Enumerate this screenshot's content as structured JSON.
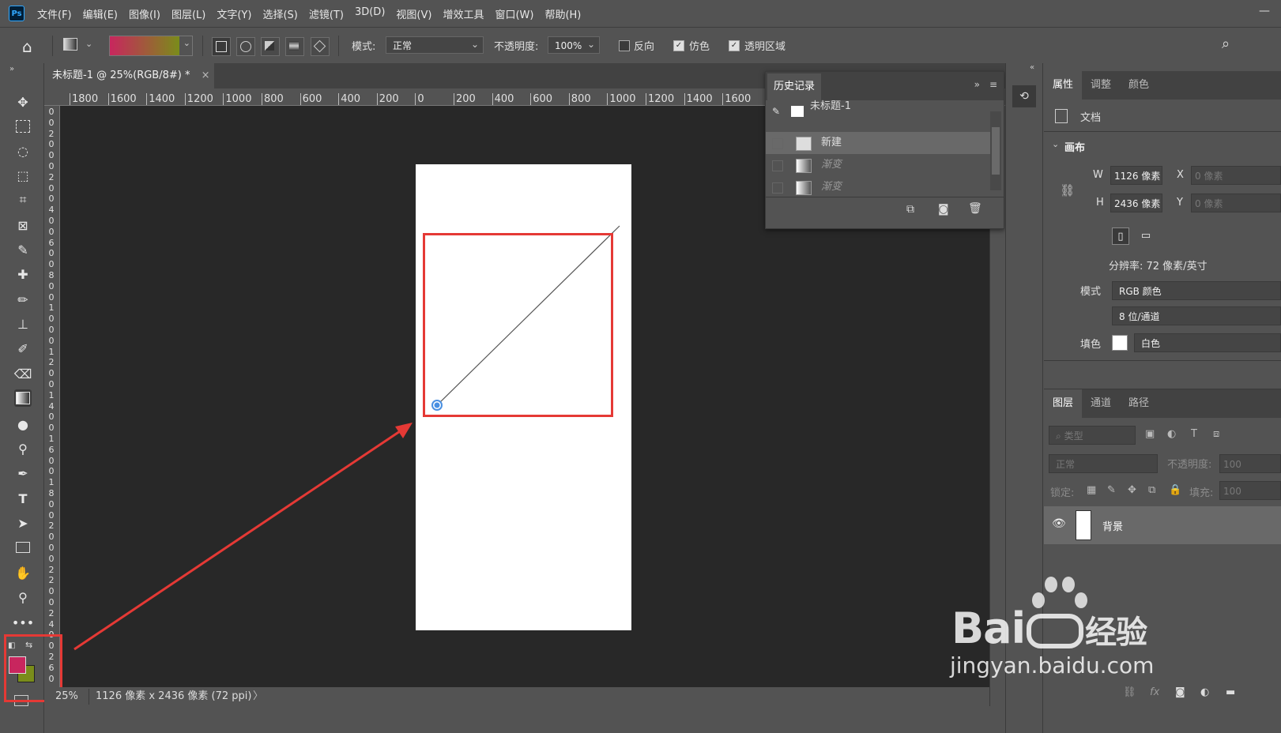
{
  "menu": {
    "app_logo": "Ps",
    "items": [
      "文件(F)",
      "编辑(E)",
      "图像(I)",
      "图层(L)",
      "文字(Y)",
      "选择(S)",
      "滤镜(T)",
      "3D(D)",
      "视图(V)",
      "增效工具",
      "窗口(W)",
      "帮助(H)"
    ],
    "minimize": "—"
  },
  "options": {
    "mode_label": "模式:",
    "mode_value": "正常",
    "opacity_label": "不透明度:",
    "opacity_value": "100%",
    "reverse_label": "反向",
    "dither_label": "仿色",
    "transparency_label": "透明区域",
    "gradient_colors": [
      "#c8265e",
      "#7a8c1a"
    ]
  },
  "document": {
    "tab_title": "未标题-1 @ 25%(RGB/8#) *",
    "tab_close": "×",
    "ruler_h": [
      "1800",
      "1600",
      "1400",
      "1200",
      "1000",
      "800",
      "600",
      "400",
      "200",
      "0",
      "200",
      "400",
      "600",
      "800",
      "1000",
      "1200",
      "1400",
      "1600"
    ],
    "ruler_v": [
      "0",
      "0",
      "2",
      "0",
      "0",
      "0",
      "2",
      "0",
      "0",
      "4",
      "0",
      "0",
      "6",
      "0",
      "0",
      "8",
      "0",
      "0",
      "1",
      "0",
      "0",
      "0",
      "1",
      "2",
      "0",
      "0",
      "1",
      "4",
      "0",
      "0",
      "1",
      "6",
      "0",
      "0",
      "1",
      "8",
      "0",
      "0",
      "2",
      "0",
      "0",
      "0",
      "2",
      "2",
      "0",
      "0",
      "2",
      "4",
      "0",
      "0",
      "2",
      "6",
      "0"
    ],
    "zoom": "25%",
    "status": "1126 像素 x 2436 像素 (72 ppi)",
    "status_arrow": "〉"
  },
  "history": {
    "tab": "历史记录",
    "snapshot": "未标题-1",
    "rows": [
      {
        "label": "新建",
        "active": true,
        "dim": false
      },
      {
        "label": "渐变",
        "active": false,
        "dim": true
      },
      {
        "label": "渐变",
        "active": false,
        "dim": true
      }
    ]
  },
  "properties": {
    "tabs": [
      "属性",
      "调整",
      "颜色"
    ],
    "doc_label": "文档",
    "canvas_label": "画布",
    "w_label": "W",
    "w_value": "1126 像素",
    "h_label": "H",
    "h_value": "2436 像素",
    "x_label": "X",
    "x_value": "0 像素",
    "y_label": "Y",
    "y_value": "0 像素",
    "resolution": "分辨率: 72 像素/英寸",
    "mode_label": "模式",
    "mode_value": "RGB 颜色",
    "depth_value": "8 位/通道",
    "fill_label": "填色",
    "fill_value": "白色"
  },
  "layers": {
    "tabs": [
      "图层",
      "通道",
      "路径"
    ],
    "filter_placeholder": "类型",
    "blend_mode": "正常",
    "opacity_label": "不透明度:",
    "opacity_value": "100",
    "lock_label": "锁定:",
    "fill_label": "填充:",
    "fill_value": "100",
    "layer_name": "背景",
    "footer_fx": "fx"
  },
  "colors": {
    "foreground": "#c8265e",
    "background": "#7a8c1a",
    "annotation": "#e53935",
    "gradient_point": "#4a90e2"
  },
  "watermark": {
    "brand_left": "Bai",
    "brand_right": "经验",
    "url": "jingyan.baidu.com"
  }
}
